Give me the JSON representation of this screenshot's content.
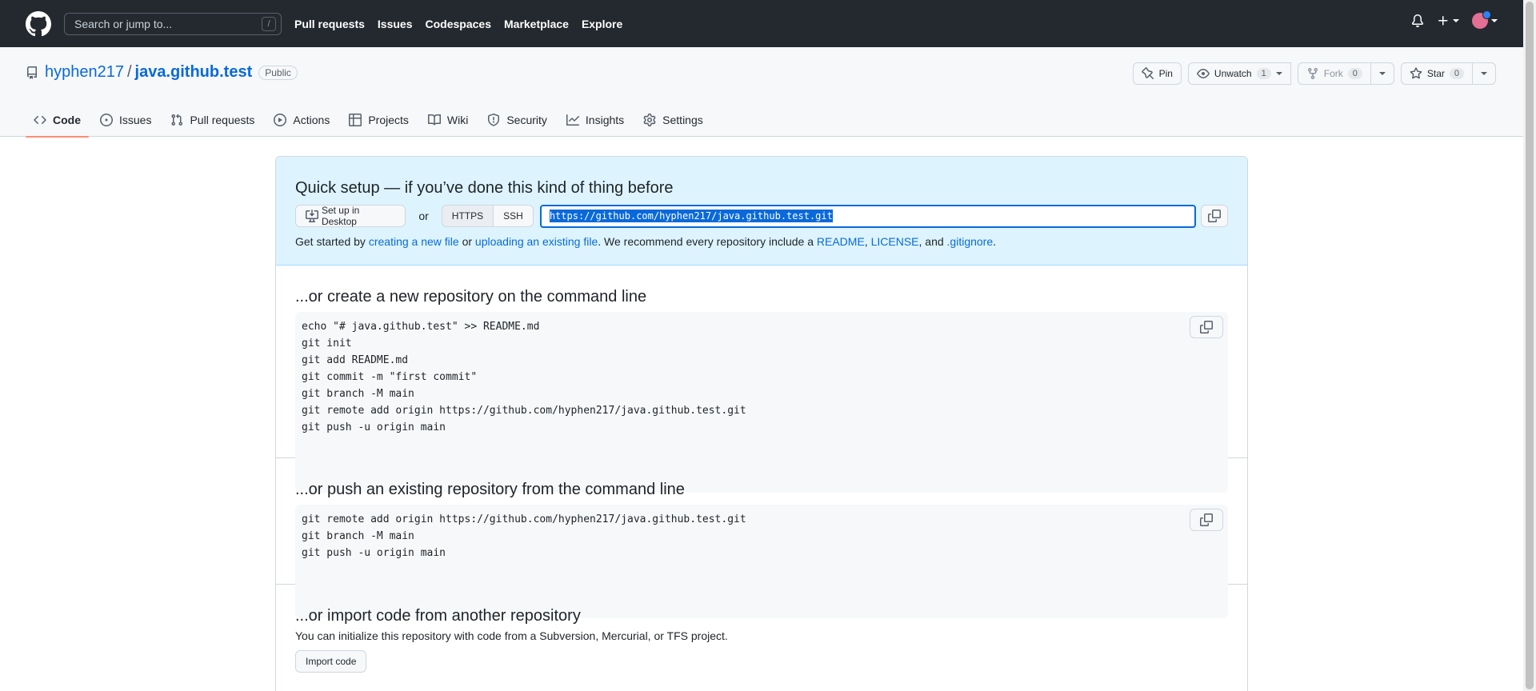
{
  "header": {
    "search_placeholder": "Search or jump to...",
    "search_kbd": "/",
    "nav": [
      "Pull requests",
      "Issues",
      "Codespaces",
      "Marketplace",
      "Explore"
    ]
  },
  "repo": {
    "owner": "hyphen217",
    "separator": "/",
    "name": "java.github.test",
    "visibility": "Public",
    "pin_label": "Pin",
    "unwatch_label": "Unwatch",
    "watch_count": "1",
    "fork_label": "Fork",
    "fork_count": "0",
    "star_label": "Star",
    "star_count": "0"
  },
  "tabs": [
    {
      "label": "Code",
      "icon": "code-icon"
    },
    {
      "label": "Issues",
      "icon": "issue-icon"
    },
    {
      "label": "Pull requests",
      "icon": "pull-request-icon"
    },
    {
      "label": "Actions",
      "icon": "play-icon"
    },
    {
      "label": "Projects",
      "icon": "table-icon"
    },
    {
      "label": "Wiki",
      "icon": "book-icon"
    },
    {
      "label": "Security",
      "icon": "shield-icon"
    },
    {
      "label": "Insights",
      "icon": "graph-icon"
    },
    {
      "label": "Settings",
      "icon": "gear-icon"
    }
  ],
  "quick_setup": {
    "title": "Quick setup — if you’ve done this kind of thing before",
    "desktop_button": "Set up in Desktop",
    "or": "or",
    "https_label": "HTTPS",
    "ssh_label": "SSH",
    "clone_url": "https://github.com/hyphen217/java.github.test.git",
    "hint_prefix": "Get started by",
    "hint_link1": "creating a new file",
    "hint_or": "or",
    "hint_link2": "uploading an existing file",
    "hint_mid": ". We recommend every repository include a",
    "hint_readme": "README",
    "hint_comma": ",",
    "hint_license": "LICENSE",
    "hint_and": ", and",
    "hint_gitignore": ".gitignore",
    "hint_end": "."
  },
  "new_repo": {
    "title": "...or create a new repository on the command line",
    "lines": [
      "echo \"# java.github.test\" >> README.md",
      "git init",
      "git add README.md",
      "git commit -m \"first commit\"",
      "git branch -M main",
      "git remote add origin https://github.com/hyphen217/java.github.test.git",
      "git push -u origin main"
    ]
  },
  "push_existing": {
    "title": "...or push an existing repository from the command line",
    "lines": [
      "git remote add origin https://github.com/hyphen217/java.github.test.git",
      "git branch -M main",
      "git push -u origin main"
    ]
  },
  "import": {
    "title": "...or import code from another repository",
    "desc": "You can initialize this repository with code from a Subversion, Mercurial, or TFS project.",
    "button": "Import code"
  }
}
